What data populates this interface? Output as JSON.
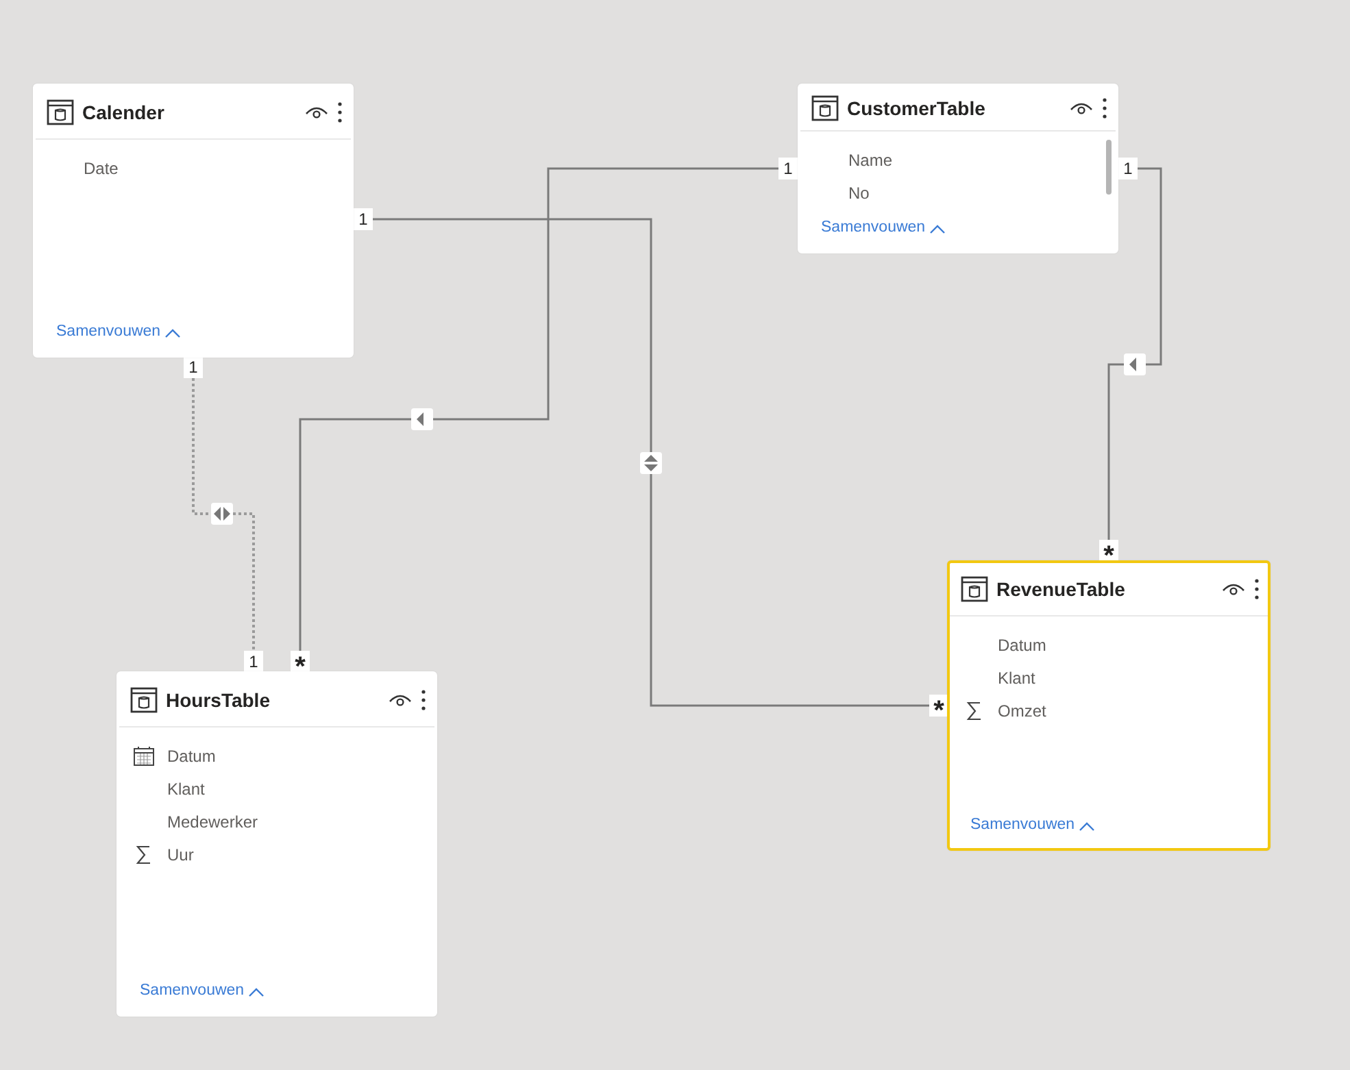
{
  "tables": [
    {
      "name": "Calender",
      "selected": false,
      "scrollable": false,
      "columns": [
        {
          "name": "Date",
          "kind": "text"
        }
      ],
      "collapse_link": "Samenvouwen"
    },
    {
      "name": "CustomerTable",
      "selected": false,
      "scrollable": true,
      "columns": [
        {
          "name": "Name",
          "kind": "text"
        },
        {
          "name": "No",
          "kind": "text"
        }
      ],
      "collapse_link": "Samenvouwen"
    },
    {
      "name": "HoursTable",
      "selected": false,
      "scrollable": false,
      "columns": [
        {
          "name": "Datum",
          "kind": "date"
        },
        {
          "name": "Klant",
          "kind": "text"
        },
        {
          "name": "Medewerker",
          "kind": "text"
        },
        {
          "name": "Uur",
          "kind": "sum"
        }
      ],
      "collapse_link": "Samenvouwen"
    },
    {
      "name": "RevenueTable",
      "selected": true,
      "scrollable": false,
      "columns": [
        {
          "name": "Datum",
          "kind": "text"
        },
        {
          "name": "Klant",
          "kind": "text"
        },
        {
          "name": "Omzet",
          "kind": "sum"
        }
      ],
      "collapse_link": "Samenvouwen"
    }
  ],
  "relationships": [
    {
      "from_label": "1",
      "to_label": "*",
      "bidirectional": true,
      "inactive": false
    },
    {
      "from_label": "1",
      "to_label": "*",
      "bidirectional": false,
      "inactive": false
    },
    {
      "from_label": "1",
      "to_label": "*",
      "bidirectional": false,
      "inactive": false
    },
    {
      "from_label": "1",
      "to_label": "1",
      "bidirectional": true,
      "inactive": true
    }
  ]
}
